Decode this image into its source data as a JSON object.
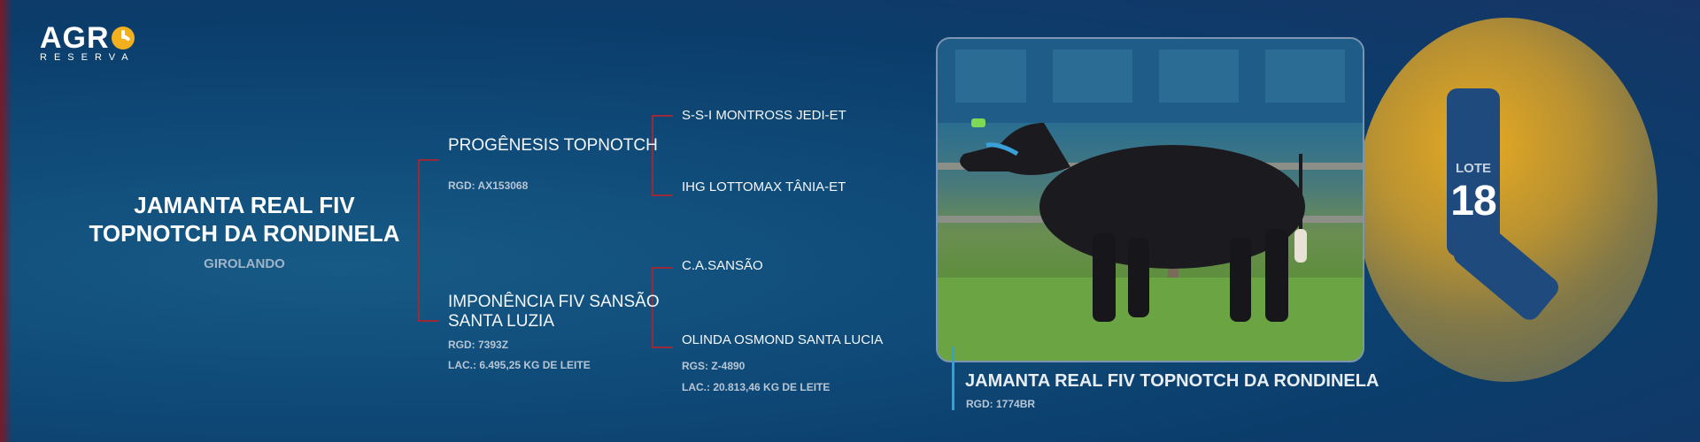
{
  "logo": {
    "main": "AGR",
    "sub": "RESERVA"
  },
  "animal": {
    "name_line1": "JAMANTA REAL FIV",
    "name_line2": "TOPNOTCH DA RONDINELA",
    "breed": "GIROLANDO"
  },
  "pedigree": {
    "sire": {
      "name": "PROGÊNESIS TOPNOTCH",
      "rgd": "RGD: AX153068"
    },
    "dam": {
      "name_line1": "IMPONÊNCIA FIV SANSÃO",
      "name_line2": "SANTA LUZIA",
      "rgd": "RGD: 7393Z",
      "lac": "LAC.: 6.495,25 KG DE LEITE"
    },
    "sire_sire": {
      "name": "S-S-I MONTROSS JEDI-ET"
    },
    "sire_dam": {
      "name": "IHG LOTTOMAX TÂNIA-ET"
    },
    "dam_sire": {
      "name": "C.A.SANSÃO"
    },
    "dam_dam": {
      "name": "OLINDA OSMOND SANTA LUCIA",
      "rgs": "RGS: Z-4890",
      "lac": "LAC.: 20.813,46 KG DE LEITE"
    }
  },
  "lote": {
    "label": "LOTE",
    "number": "18"
  },
  "caption": {
    "title": "JAMANTA REAL FIV TOPNOTCH DA RONDINELA",
    "rgd": "RGD: 1774BR"
  },
  "colors": {
    "background": "#0f4a78",
    "accent_gold": "#f2b01e",
    "bracket_red": "#9b2a38",
    "caption_bar": "#2fa3d8"
  }
}
